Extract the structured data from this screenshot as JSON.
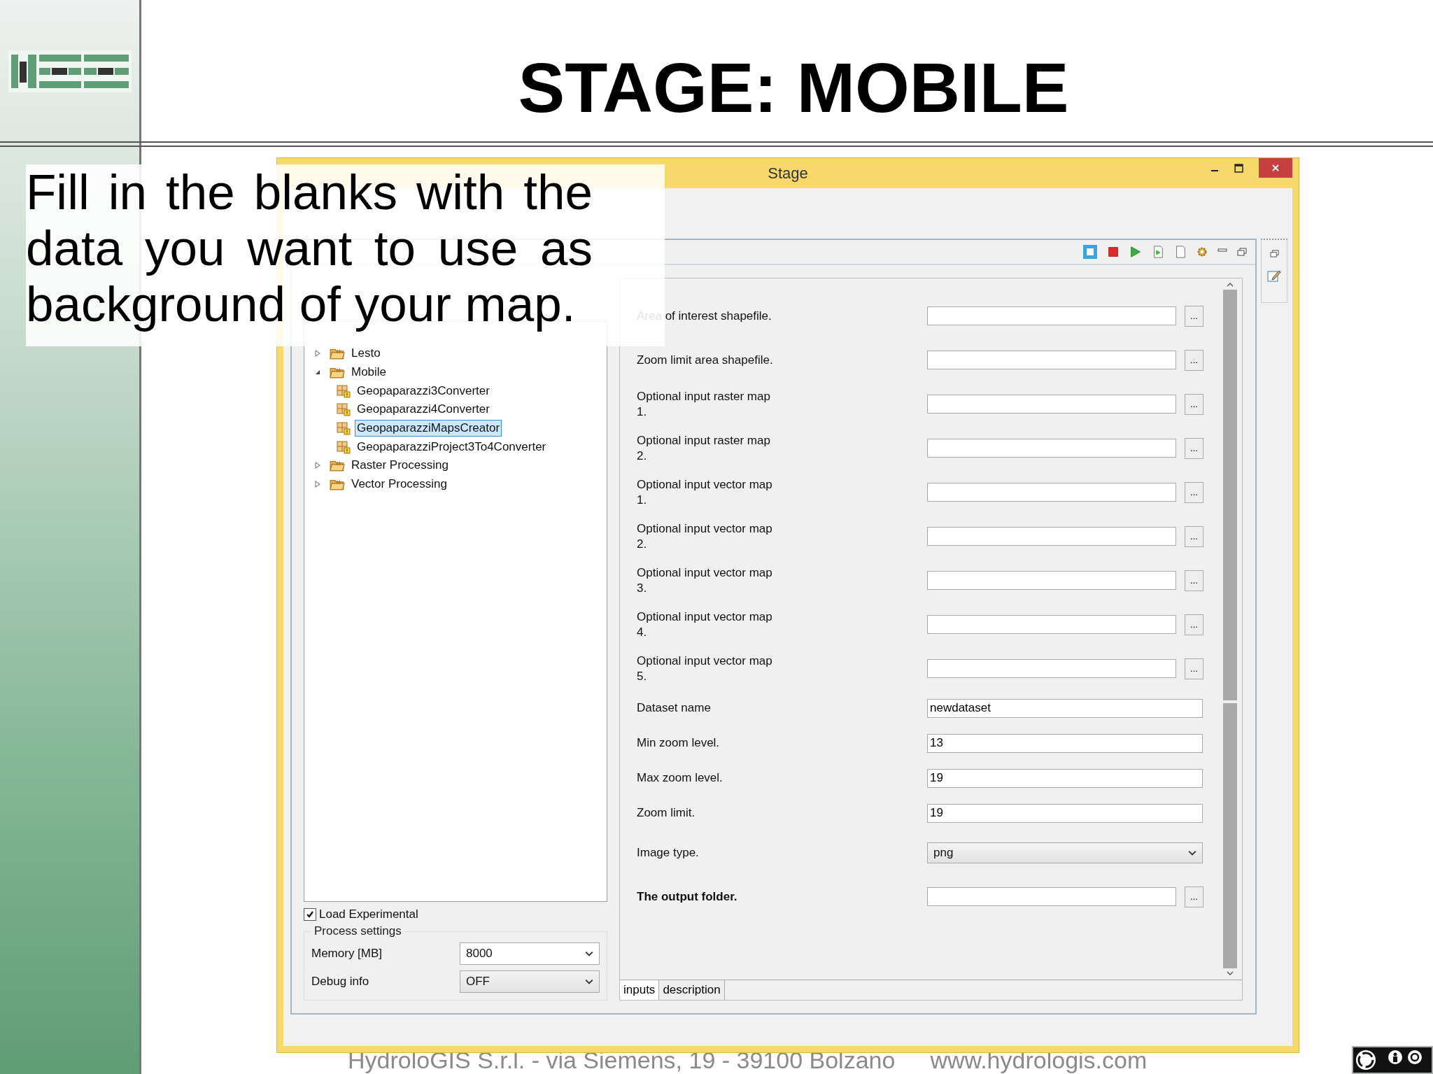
{
  "slide": {
    "title": "STAGE: MOBILE",
    "caption": "Fill in the blanks with the data you want to use as background of your map.",
    "footer": [
      "HydroloGIS S.r.l. - via Siemens, 19 - 39100 Bolzano",
      "www.hydrologis.com"
    ]
  },
  "window": {
    "title": "Stage"
  },
  "modules": {
    "tree": [
      {
        "kind": "folder",
        "label": "Lesto",
        "expanded": false
      },
      {
        "kind": "folder",
        "label": "Mobile",
        "expanded": true,
        "children": [
          {
            "kind": "module",
            "label": "Geopaparazzi3Converter",
            "selected": false
          },
          {
            "kind": "module",
            "label": "Geopaparazzi4Converter",
            "selected": false
          },
          {
            "kind": "module",
            "label": "GeopaparazziMapsCreator",
            "selected": true
          },
          {
            "kind": "module",
            "label": "GeopaparazziProject3To4Converter",
            "selected": false
          }
        ]
      },
      {
        "kind": "folder",
        "label": "Raster Processing",
        "expanded": false
      },
      {
        "kind": "folder",
        "label": "Vector Processing",
        "expanded": false
      }
    ]
  },
  "load_experimental": {
    "label": "Load Experimental",
    "checked": true
  },
  "process_settings": {
    "title": "Process settings",
    "fields": [
      {
        "label": "Memory [MB]",
        "value": "8000",
        "kind": "editable"
      },
      {
        "label": "Debug info",
        "value": "OFF",
        "kind": "readonly"
      }
    ]
  },
  "inputs": [
    {
      "kind": "file",
      "label": "Area of interest shapefile.",
      "required": false
    },
    {
      "kind": "file",
      "label": "Zoom limit area shapefile.",
      "required": false
    },
    {
      "kind": "file",
      "label": "Optional input raster map 1.",
      "required": false
    },
    {
      "kind": "file",
      "label": "Optional input raster map 2.",
      "required": false
    },
    {
      "kind": "file",
      "label": "Optional input vector map 1.",
      "required": false
    },
    {
      "kind": "file",
      "label": "Optional input vector map 2.",
      "required": false
    },
    {
      "kind": "file",
      "label": "Optional input vector map 3.",
      "required": false
    },
    {
      "kind": "file",
      "label": "Optional input vector map 4.",
      "required": false
    },
    {
      "kind": "file",
      "label": "Optional input vector map 5.",
      "required": false
    },
    {
      "kind": "text",
      "label": "Dataset name",
      "value": "newdataset",
      "required": false
    },
    {
      "kind": "text",
      "label": "Min zoom level.",
      "value": "13",
      "required": false
    },
    {
      "kind": "text",
      "label": "Max zoom level.",
      "value": "19",
      "required": false
    },
    {
      "kind": "text",
      "label": "Zoom limit.",
      "value": "19",
      "required": false
    },
    {
      "kind": "choice",
      "label": "Image type.",
      "value": "png",
      "required": false
    },
    {
      "kind": "file",
      "label": "The output folder.",
      "required": true
    }
  ],
  "browse_label": "...",
  "tabs": [
    {
      "label": "inputs",
      "selected": true
    },
    {
      "label": "description",
      "selected": false
    }
  ]
}
